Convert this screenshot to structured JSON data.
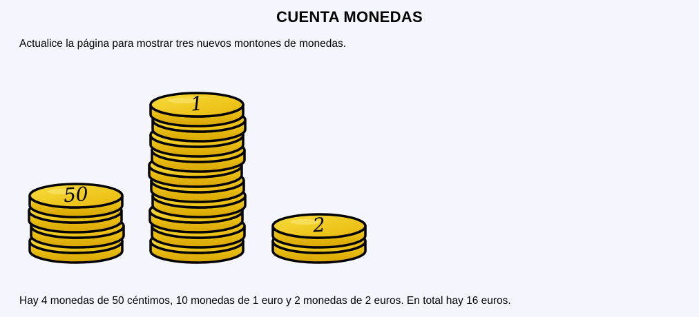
{
  "title": "CUENTA MONEDAS",
  "instruction": "Actualice la página para mostrar tres nuevos montones de monedas.",
  "stacks": [
    {
      "label": "50",
      "count": 4
    },
    {
      "label": "1",
      "count": 10
    },
    {
      "label": "2",
      "count": 2
    }
  ],
  "summary": "Hay 4 monedas de 50 céntimos, 10 monedas de 1 euro y 2 monedas de 2 euros. En total hay 16 euros.",
  "colors": {
    "coin_gold": "#f2cb19",
    "coin_dark": "#d9a300",
    "outline": "#000000",
    "background": "#f5f5fd"
  }
}
